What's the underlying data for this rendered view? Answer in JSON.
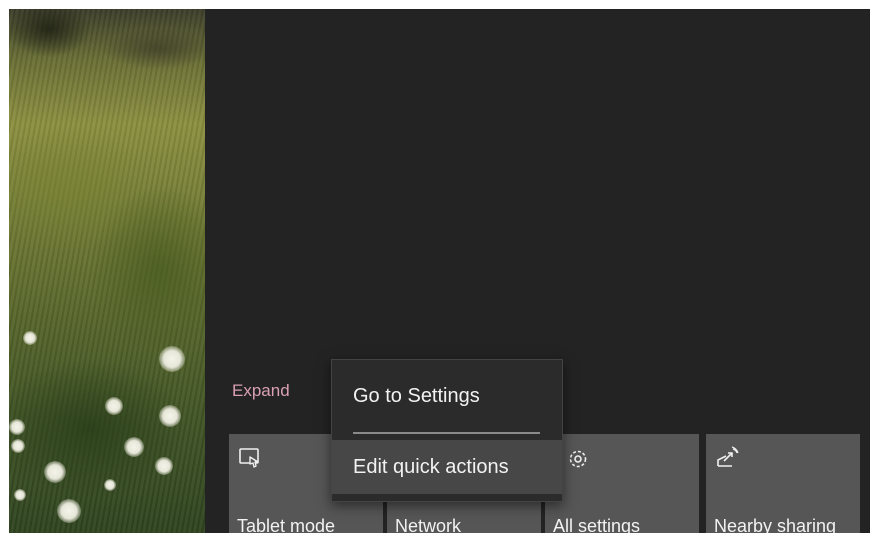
{
  "action_center": {
    "expand_label": "Expand",
    "tiles": [
      {
        "label": "Tablet mode",
        "icon": "tablet-mode-icon"
      },
      {
        "label": "Network",
        "icon": "network-icon"
      },
      {
        "label": "All settings",
        "icon": "gear-icon"
      },
      {
        "label": "Nearby sharing",
        "icon": "nearby-sharing-icon"
      }
    ]
  },
  "context_menu": {
    "items": [
      {
        "label": "Go to Settings"
      },
      {
        "label": "Edit quick actions",
        "highlighted": true
      }
    ]
  },
  "colors": {
    "panel_background": "#232323",
    "tile_background": "#565656",
    "menu_background": "#2b2b2b",
    "menu_highlight": "#474747",
    "expand_link": "#d9a0b4"
  }
}
